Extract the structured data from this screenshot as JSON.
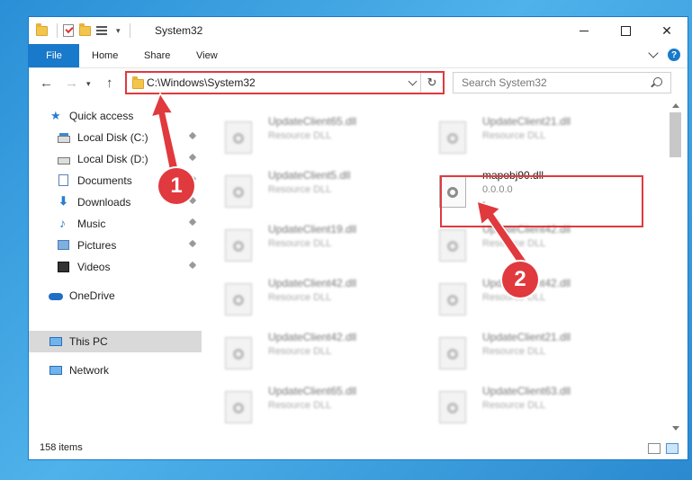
{
  "window": {
    "title": "System32"
  },
  "ribbon": {
    "tabs": [
      "File",
      "Home",
      "Share",
      "View"
    ],
    "help": "?"
  },
  "nav": {
    "address": "C:\\Windows\\System32",
    "search_placeholder": "Search System32",
    "back": "←",
    "forward": "→",
    "up": "↑",
    "refresh": "↻"
  },
  "sidebar": {
    "items": [
      {
        "label": "Quick access",
        "icon": "star-icon"
      },
      {
        "label": "Local Disk (C:)",
        "icon": "disk-icon"
      },
      {
        "label": "Local Disk (D:)",
        "icon": "disk-icon"
      },
      {
        "label": "Documents",
        "icon": "documents-icon"
      },
      {
        "label": "Downloads",
        "icon": "download-icon"
      },
      {
        "label": "Music",
        "icon": "music-icon"
      },
      {
        "label": "Pictures",
        "icon": "pictures-icon"
      },
      {
        "label": "Videos",
        "icon": "videos-icon"
      },
      {
        "label": "OneDrive",
        "icon": "cloud-icon"
      },
      {
        "label": "This PC",
        "icon": "computer-icon"
      },
      {
        "label": "Network",
        "icon": "network-icon"
      }
    ]
  },
  "files": [
    {
      "name": "UpdateClient65.dll",
      "sub": "Resource DLL"
    },
    {
      "name": "UpdateClient21.dll",
      "sub": "Resource DLL"
    },
    {
      "name": "UpdateClient5.dll",
      "sub": "Resource DLL"
    },
    {
      "name": "mapobj90.dll",
      "sub": "0.0.0.0",
      "sub2": "-"
    },
    {
      "name": "UpdateClient19.dll",
      "sub": "Resource DLL"
    },
    {
      "name": "UpdateClient42.dll",
      "sub": "Resource DLL"
    },
    {
      "name": "UpdateClient42.dll",
      "sub": "Resource DLL"
    },
    {
      "name": "UpdateClient42.dll",
      "sub": "Resource DLL"
    },
    {
      "name": "UpdateClient42.dll",
      "sub": "Resource DLL"
    },
    {
      "name": "UpdateClient21.dll",
      "sub": "Resource DLL"
    },
    {
      "name": "UpdateClient65.dll",
      "sub": "Resource DLL"
    },
    {
      "name": "UpdateClient63.dll",
      "sub": "Resource DLL"
    }
  ],
  "status": {
    "count": "158 items"
  },
  "annotations": {
    "step1": "1",
    "step2": "2",
    "color": "#e0393e"
  },
  "colors": {
    "accent": "#1979ca",
    "highlight": "#e0393e"
  }
}
